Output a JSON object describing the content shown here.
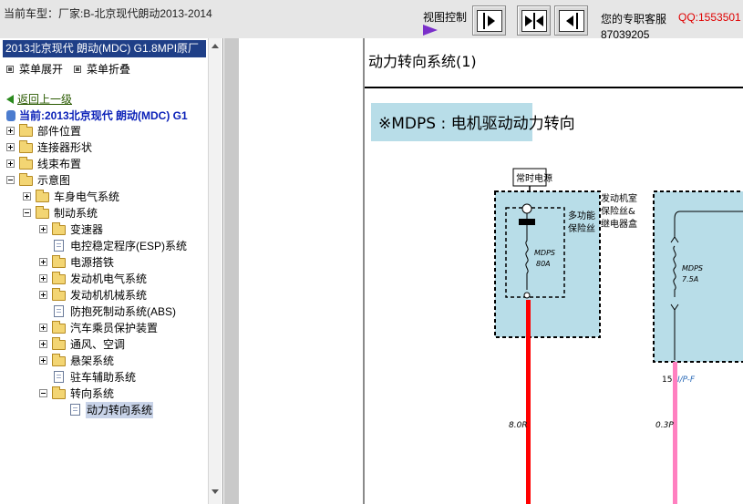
{
  "header": {
    "vehicle": "当前车型：厂家:B-北京现代朗动2013-2014",
    "view_control": "视图控制",
    "hotline": "您的专职客服",
    "qq": "QQ:1553501",
    "phone": "87039205"
  },
  "sidebar": {
    "model": "2013北京现代 朗动(MDC) G1.8MPI原厂",
    "expand_menu": "菜单展开",
    "collapse_menu": "菜单折叠",
    "back": "返回上一级",
    "current": "当前:2013北京现代 朗动(MDC) G1",
    "tree": {
      "parts": "部件位置",
      "connectors": "连接器形状",
      "harness": "线束布置",
      "schematic": "示意图",
      "body": "车身电气系统",
      "brake": "制动系统",
      "transmission": "变速器",
      "esp": "电控稳定程序(ESP)系统",
      "power": "电源搭铁",
      "engine_elec": "发动机电气系统",
      "engine_mech": "发动机机械系统",
      "abs": "防抱死制动系统(ABS)",
      "srs": "汽车乘员保护装置",
      "hvac": "通风、空调",
      "suspension": "悬架系统",
      "parking": "驻车辅助系统",
      "steering": "转向系统",
      "power_steering": "动力转向系统"
    }
  },
  "diagram": {
    "title": "动力转向系统(1)",
    "subtitle": "※MDPS : 电机驱动动力转向",
    "battery_power": "常时电源",
    "engine_room_box": [
      "发动机室",
      "保险丝&",
      "继电器盒"
    ],
    "multi_fuse": [
      "多功能",
      "保险丝"
    ],
    "fuse1": [
      "MDPS",
      "80A"
    ],
    "fuse2": [
      "MDPS",
      "7.5A"
    ],
    "pin": "15",
    "connector": "I/P-F",
    "wire1": "8.0R",
    "wire2": "0.3P"
  },
  "colors": {
    "wire_red": "#ff0000",
    "wire_pink": "#ff80c0",
    "box_fill": "#b8dde8",
    "model_bar": "#1f3f87",
    "qq_red": "#e00000"
  }
}
